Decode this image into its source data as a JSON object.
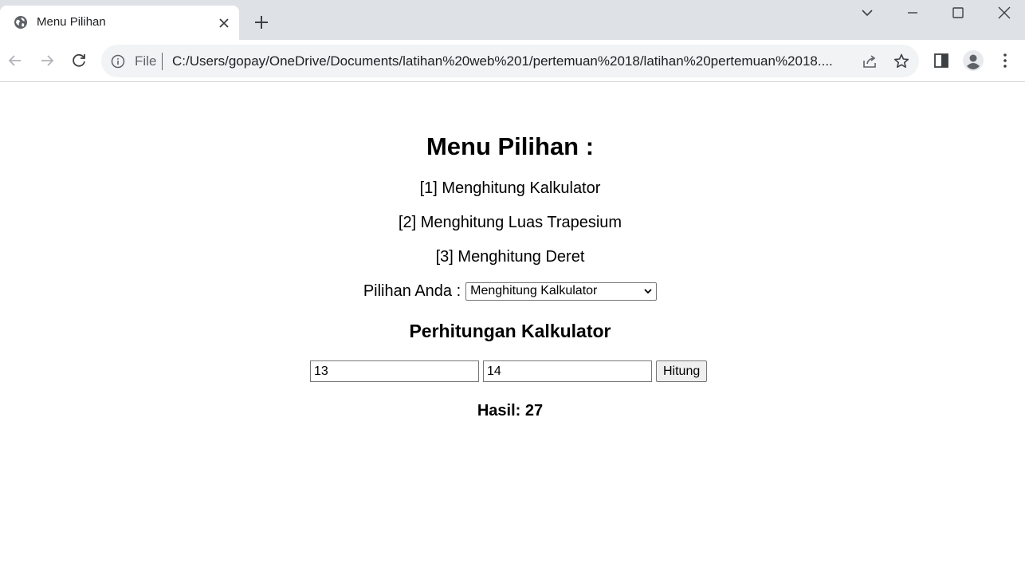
{
  "browser": {
    "tab_title": "Menu Pilihan",
    "scheme_label": "File",
    "url": "C:/Users/gopay/OneDrive/Documents/latihan%20web%201/pertemuan%2018/latihan%20pertemuan%2018...."
  },
  "page": {
    "title": "Menu Pilihan :",
    "menu_items": [
      "[1] Menghitung Kalkulator",
      "[2] Menghitung Luas Trapesium",
      "[3] Menghitung Deret"
    ],
    "choice_label": "Pilihan Anda :",
    "choice_selected": "Menghitung Kalkulator",
    "section_title": "Perhitungan Kalkulator",
    "input_a": "13",
    "input_b": "14",
    "button_label": "Hitung",
    "result": "Hasil: 27"
  }
}
